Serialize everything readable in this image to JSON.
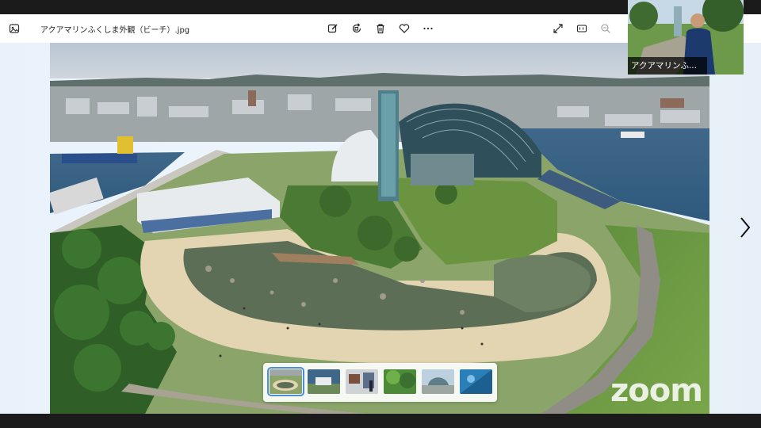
{
  "viewer": {
    "filename": "アクアマリンふくしま外観（ビーチ）.jpg",
    "icons": [
      "photos-app-icon",
      "edit-icon",
      "rotate-icon",
      "delete-icon",
      "favorite-icon",
      "more-icon",
      "fullscreen-icon",
      "actual-size-icon",
      "zoom-out-icon"
    ],
    "thumbnails": [
      "aquarium-beach-aerial",
      "aquarium-building-sea",
      "exhibit-hall",
      "green-canopy",
      "building-exterior",
      "blue-tank"
    ],
    "selected_thumbnail": 0
  },
  "participant": {
    "name": "アクアマリンふ..."
  },
  "watermark": "zoom"
}
